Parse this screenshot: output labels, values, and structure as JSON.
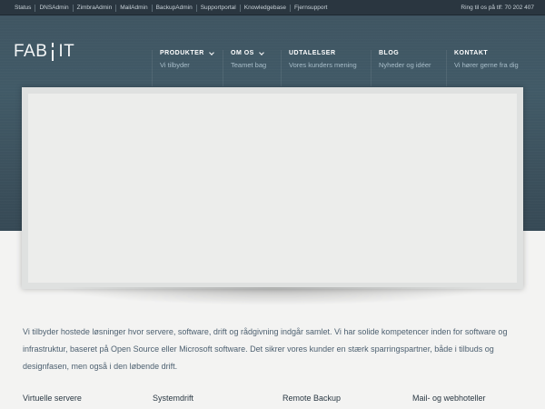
{
  "topbar": {
    "links": [
      "Status",
      "DNSAdmin",
      "ZimbraAdmin",
      "MailAdmin",
      "BackupAdmin",
      "Supportportal",
      "Knowledgebase",
      "Fjernsupport"
    ],
    "phone": "Ring til os på tlf: 70 202 407"
  },
  "logo": {
    "left": "FAB",
    "right": "IT"
  },
  "nav": {
    "items": [
      {
        "title": "PRODUKTER",
        "subtitle": "Vi tilbyder",
        "has_dropdown": true
      },
      {
        "title": "OM OS",
        "subtitle": "Teamet bag",
        "has_dropdown": true
      },
      {
        "title": "UDTALELSER",
        "subtitle": "Vores kunders mening",
        "has_dropdown": false
      },
      {
        "title": "BLOG",
        "subtitle": "Nyheder og idéer",
        "has_dropdown": false
      },
      {
        "title": "KONTAKT",
        "subtitle": "Vi hører gerne fra dig",
        "has_dropdown": false
      }
    ]
  },
  "intro": "Vi tilbyder hostede løsninger hvor servere, software, drift og rådgivning indgår samlet. Vi har solide kompetencer inden for software og infrastruktur, baseret på Open Source eller Microsoft software. Det sikrer vores kunder en stærk sparringspartner, både i tilbuds og designfasen, men også i den løbende drift.",
  "services": [
    "Virtuelle servere",
    "Systemdrift",
    "Remote Backup",
    "Mail- og webhoteller"
  ],
  "colors": {
    "header": "#3f5562",
    "topbar": "#2a3640",
    "body_text": "#4d6070",
    "page_bg": "#f3f3f2"
  }
}
